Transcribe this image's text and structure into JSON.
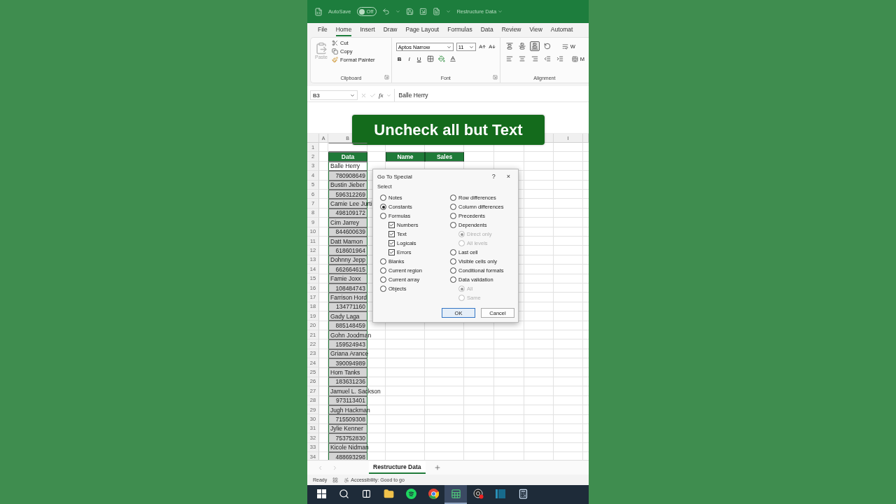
{
  "title_bar": {
    "autosave": {
      "label": "AutoSave",
      "on": false,
      "state_text": "Off"
    },
    "document_title": "Restructure Data"
  },
  "menu_tabs": [
    {
      "label": "File",
      "selected": false
    },
    {
      "label": "Home",
      "selected": true
    },
    {
      "label": "Insert",
      "selected": false
    },
    {
      "label": "Draw",
      "selected": false
    },
    {
      "label": "Page Layout",
      "selected": false
    },
    {
      "label": "Formulas",
      "selected": false
    },
    {
      "label": "Data",
      "selected": false
    },
    {
      "label": "Review",
      "selected": false
    },
    {
      "label": "View",
      "selected": false
    },
    {
      "label": "Automat",
      "selected": false
    }
  ],
  "ribbon": {
    "clipboard": {
      "paste": {
        "label": "Paste",
        "disabled": true
      },
      "cut": "Cut",
      "copy": "Copy",
      "format_painter": "Format Painter",
      "group_label": "Clipboard"
    },
    "font": {
      "font_name": "Aptos Narrow",
      "font_size": "11",
      "bold": "B",
      "italic": "I",
      "underline": "U",
      "group_label": "Font"
    },
    "alignment": {
      "buttons": [
        {
          "kind": "top",
          "selected": false
        },
        {
          "kind": "middle",
          "selected": false
        },
        {
          "kind": "bottom",
          "selected": true
        },
        {
          "kind": "orientation",
          "selected": false
        },
        {
          "kind": "left",
          "selected": false
        },
        {
          "kind": "center",
          "selected": false
        },
        {
          "kind": "right",
          "selected": false
        },
        {
          "kind": "outdent",
          "selected": false
        },
        {
          "kind": "indent",
          "selected": false
        }
      ],
      "wrap_label": "W",
      "merge_label": "M",
      "group_label": "Alignment"
    }
  },
  "formula_bar": {
    "name_box": "B3",
    "function_label": "fx",
    "value": "Balle Herry"
  },
  "caption": "Uncheck all but Text",
  "sheet": {
    "column_headers": [
      {
        "label": "A"
      },
      {
        "label": "B"
      },
      {
        "label": "I"
      }
    ],
    "rows": [
      {
        "number": "1",
        "kind": "empty",
        "selected": false,
        "active": false
      },
      {
        "number": "2",
        "kind": "header",
        "B": "Data",
        "D": "Name",
        "E": "Sales",
        "selected": false,
        "active": false
      },
      {
        "number": "3",
        "kind": "text",
        "B": "Balle Herry",
        "selected": true,
        "active": true
      },
      {
        "number": "4",
        "kind": "number",
        "B": "780908649",
        "selected": true,
        "active": false
      },
      {
        "number": "5",
        "kind": "text",
        "B": "Bustin Jieber",
        "selected": true,
        "active": false
      },
      {
        "number": "6",
        "kind": "number",
        "B": "596312269",
        "selected": true,
        "active": false
      },
      {
        "number": "7",
        "kind": "text",
        "B": "Camie Lee Jurti",
        "selected": true,
        "active": false
      },
      {
        "number": "8",
        "kind": "number",
        "B": "498109172",
        "selected": true,
        "active": false
      },
      {
        "number": "9",
        "kind": "text",
        "B": "Cim Jarrey",
        "selected": true,
        "active": false
      },
      {
        "number": "10",
        "kind": "number",
        "B": "844600639",
        "selected": true,
        "active": false
      },
      {
        "number": "11",
        "kind": "text",
        "B": "Datt Mamon",
        "selected": true,
        "active": false
      },
      {
        "number": "12",
        "kind": "number",
        "B": "618601964",
        "selected": true,
        "active": false
      },
      {
        "number": "13",
        "kind": "text",
        "B": "Dohnny Jepp",
        "selected": true,
        "active": false
      },
      {
        "number": "14",
        "kind": "number",
        "B": "662664615",
        "selected": true,
        "active": false
      },
      {
        "number": "15",
        "kind": "text",
        "B": "Famie Joxx",
        "selected": true,
        "active": false
      },
      {
        "number": "16",
        "kind": "number",
        "B": "108484743",
        "selected": true,
        "active": false
      },
      {
        "number": "17",
        "kind": "text",
        "B": "Farrison Hord",
        "selected": true,
        "active": false
      },
      {
        "number": "18",
        "kind": "number",
        "B": "134771160",
        "selected": true,
        "active": false
      },
      {
        "number": "19",
        "kind": "text",
        "B": "Gady Laga",
        "selected": true,
        "active": false
      },
      {
        "number": "20",
        "kind": "number",
        "B": "885148459",
        "selected": true,
        "active": false
      },
      {
        "number": "21",
        "kind": "text",
        "B": "Gohn Joodman",
        "selected": true,
        "active": false
      },
      {
        "number": "22",
        "kind": "number",
        "B": "159524943",
        "selected": true,
        "active": false
      },
      {
        "number": "23",
        "kind": "text",
        "B": "Griana Arance",
        "selected": true,
        "active": false
      },
      {
        "number": "24",
        "kind": "number",
        "B": "390094989",
        "selected": true,
        "active": false
      },
      {
        "number": "25",
        "kind": "text",
        "B": "Hom Tanks",
        "selected": true,
        "active": false
      },
      {
        "number": "26",
        "kind": "number",
        "B": "183631236",
        "selected": true,
        "active": false
      },
      {
        "number": "27",
        "kind": "text",
        "B": "Jamuel L. Sackson",
        "selected": true,
        "active": false
      },
      {
        "number": "28",
        "kind": "number",
        "B": "973113401",
        "selected": true,
        "active": false
      },
      {
        "number": "29",
        "kind": "text",
        "B": "Jugh Hackman",
        "selected": true,
        "active": false
      },
      {
        "number": "30",
        "kind": "number",
        "B": "715509308",
        "selected": true,
        "active": false
      },
      {
        "number": "31",
        "kind": "text",
        "B": "Jylie Kenner",
        "selected": true,
        "active": false
      },
      {
        "number": "32",
        "kind": "number",
        "B": "753752830",
        "selected": true,
        "active": false
      },
      {
        "number": "33",
        "kind": "text",
        "B": "Kicole Nidman",
        "selected": true,
        "active": false
      },
      {
        "number": "34",
        "kind": "number",
        "B": "488693298",
        "selected": true,
        "active": false
      }
    ]
  },
  "dialog": {
    "title": "Go To Special",
    "help": "?",
    "close": "×",
    "section_label": "Select",
    "left_column": [
      {
        "label": "Notes",
        "kind": "radio",
        "selected": false,
        "disabled": false
      },
      {
        "label": "Constants",
        "kind": "radio",
        "selected": true,
        "disabled": false
      },
      {
        "label": "Formulas",
        "kind": "radio",
        "selected": false,
        "disabled": false,
        "children": [
          {
            "label": "Numbers",
            "kind": "checkbox",
            "checked": true,
            "disabled": false
          },
          {
            "label": "Text",
            "kind": "checkbox",
            "checked": true,
            "disabled": false
          },
          {
            "label": "Logicals",
            "kind": "checkbox",
            "checked": true,
            "disabled": false
          },
          {
            "label": "Errors",
            "kind": "checkbox",
            "checked": true,
            "disabled": false
          }
        ]
      },
      {
        "label": "Blanks",
        "kind": "radio",
        "selected": false,
        "disabled": false
      },
      {
        "label": "Current region",
        "kind": "radio",
        "selected": false,
        "disabled": false
      },
      {
        "label": "Current array",
        "kind": "radio",
        "selected": false,
        "disabled": false
      },
      {
        "label": "Objects",
        "kind": "radio",
        "selected": false,
        "disabled": false
      }
    ],
    "right_column": [
      {
        "label": "Row differences",
        "kind": "radio",
        "selected": false,
        "disabled": false
      },
      {
        "label": "Column differences",
        "kind": "radio",
        "selected": false,
        "disabled": false
      },
      {
        "label": "Precedents",
        "kind": "radio",
        "selected": false,
        "disabled": false
      },
      {
        "label": "Dependents",
        "kind": "radio",
        "selected": false,
        "disabled": false,
        "children": [
          {
            "label": "Direct only",
            "kind": "radio",
            "selected": true,
            "disabled": true
          },
          {
            "label": "All levels",
            "kind": "radio",
            "selected": false,
            "disabled": true
          }
        ]
      },
      {
        "label": "Last cell",
        "kind": "radio",
        "selected": false,
        "disabled": false
      },
      {
        "label": "Visible cells only",
        "kind": "radio",
        "selected": false,
        "disabled": false
      },
      {
        "label": "Conditional formats",
        "kind": "radio",
        "selected": false,
        "disabled": false
      },
      {
        "label": "Data validation",
        "kind": "radio",
        "selected": false,
        "disabled": false,
        "children": [
          {
            "label": "All",
            "kind": "radio",
            "selected": true,
            "disabled": true
          },
          {
            "label": "Same",
            "kind": "radio",
            "selected": false,
            "disabled": true
          }
        ]
      }
    ],
    "buttons": [
      {
        "label": "OK",
        "kind": "default"
      },
      {
        "label": "Cancel",
        "kind": "normal"
      }
    ]
  },
  "sheet_tabs": [
    {
      "label": "Restructure Data",
      "selected": true
    }
  ],
  "status_bar": {
    "status": "Ready",
    "accessibility": "Accessibility: Good to go"
  },
  "taskbar": [
    {
      "kind": "start",
      "selected": false
    },
    {
      "kind": "search",
      "selected": false
    },
    {
      "kind": "taskview",
      "selected": false
    },
    {
      "kind": "folder",
      "selected": false
    },
    {
      "kind": "music",
      "selected": false
    },
    {
      "kind": "browser",
      "selected": false
    },
    {
      "kind": "spreadsheet",
      "selected": true
    },
    {
      "kind": "recorder",
      "selected": false
    },
    {
      "kind": "panel",
      "selected": false
    },
    {
      "kind": "calculator",
      "selected": false
    }
  ]
}
